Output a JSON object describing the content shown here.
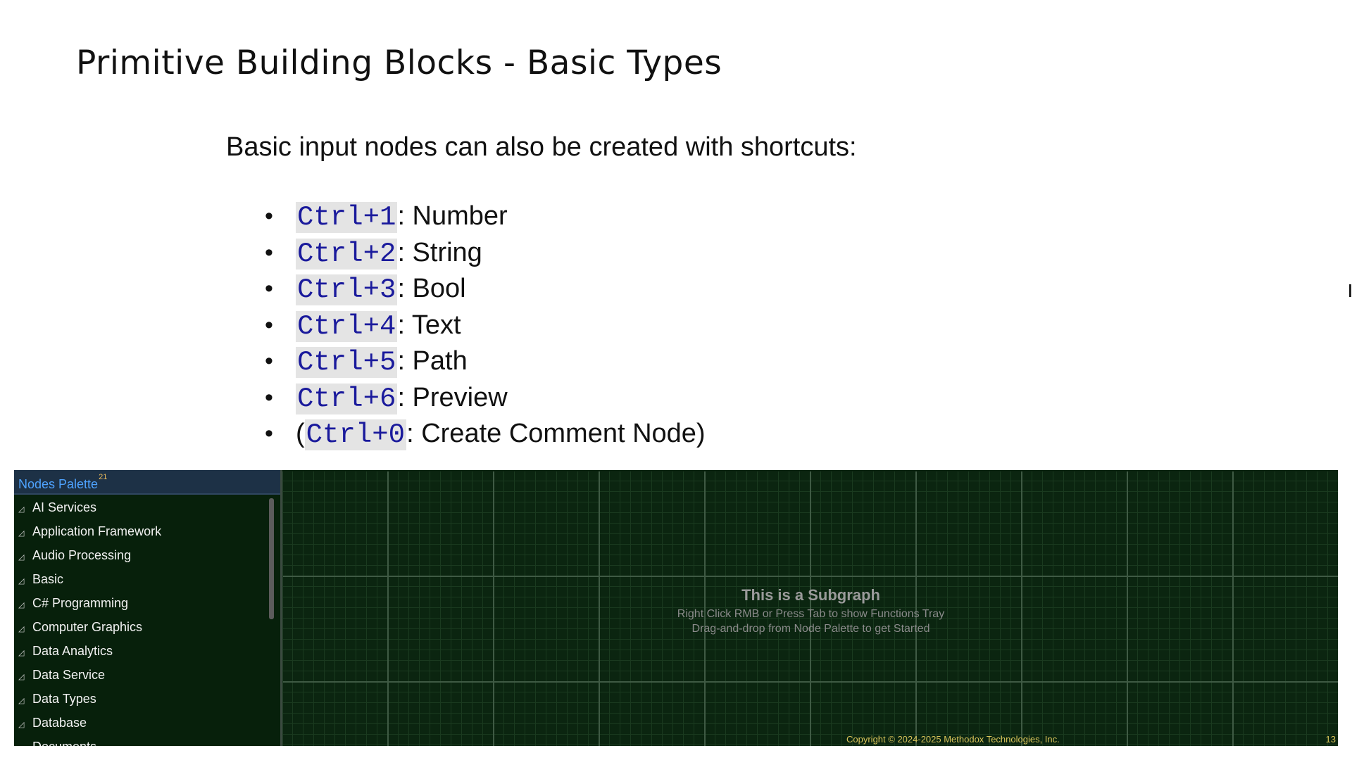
{
  "slide": {
    "title": "Primitive Building Blocks - Basic Types",
    "intro": "Basic input nodes can also be created with shortcuts:",
    "shortcuts": [
      {
        "prefix": "",
        "key": "Ctrl+1",
        "desc": ": Number"
      },
      {
        "prefix": "",
        "key": "Ctrl+2",
        "desc": ": String"
      },
      {
        "prefix": "",
        "key": "Ctrl+3",
        "desc": ": Bool"
      },
      {
        "prefix": "",
        "key": "Ctrl+4",
        "desc": ": Text"
      },
      {
        "prefix": "",
        "key": "Ctrl+5",
        "desc": ": Path"
      },
      {
        "prefix": "",
        "key": "Ctrl+6",
        "desc": ": Preview"
      },
      {
        "prefix": "(",
        "key": "Ctrl+0",
        "desc": ": Create Comment Node)"
      }
    ],
    "bullet": "•"
  },
  "palette": {
    "title": "Nodes Palette",
    "badge": "21",
    "expander": "◿",
    "items": [
      "AI Services",
      "Application Framework",
      "Audio Processing",
      "Basic",
      "C# Programming",
      "Computer Graphics",
      "Data Analytics",
      "Data Service",
      "Data Types",
      "Database",
      "Documents"
    ]
  },
  "canvas": {
    "title": "This is a Subgraph",
    "hint1": "Right Click RMB or Press Tab to show Functions Tray",
    "hint2": "Drag-and-drop from Node Palette to get Started"
  },
  "footer": {
    "copyright": "Copyright © 2024-2025 Methodox Technologies, Inc.",
    "page": "13"
  },
  "colors": {
    "key_text": "#1a1a9c",
    "key_bg": "#e4e4e4",
    "palette_title": "#4ea3ff",
    "canvas_bg": "#0b2510",
    "footer_text": "#d8c35a"
  }
}
